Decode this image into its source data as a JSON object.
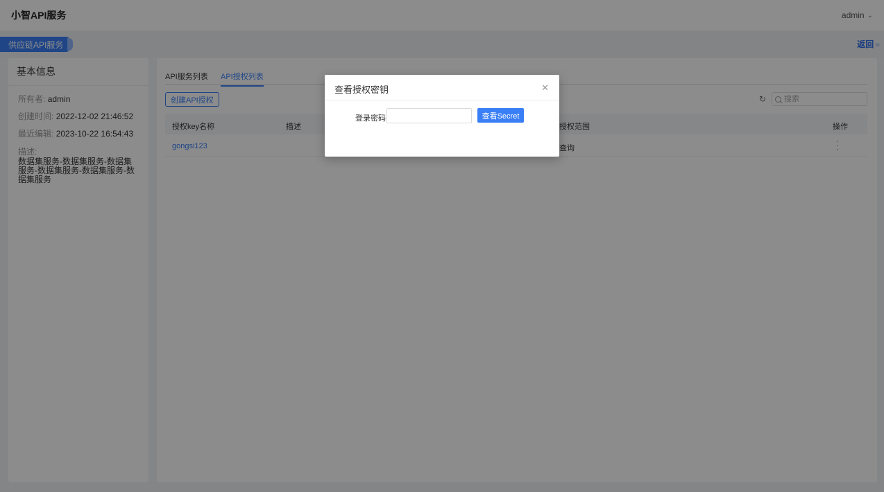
{
  "app": {
    "title": "小智API服务",
    "user": "admin"
  },
  "subbar": {
    "pill_label": "供应链API服务",
    "back_label": "返回"
  },
  "left": {
    "title": "基本信息",
    "owner_label": "所有者:",
    "owner_value": "admin",
    "created_label": "创建时间:",
    "created_value": "2022-12-02 21:46:52",
    "edited_label": "最近编辑:",
    "edited_value": "2023-10-22 16:54:43",
    "desc_label": "描述:",
    "desc_value": "数据集服务-数据集服务-数据集服务-数据集服务-数据集服务-数据集服务"
  },
  "main": {
    "tabs": [
      {
        "label": "API服务列表"
      },
      {
        "label": "API授权列表"
      }
    ],
    "create_button": "创建API授权",
    "search_placeholder": "搜索",
    "columns": [
      "授权key名称",
      "描述",
      "授权范围",
      "操作"
    ],
    "rows": [
      {
        "name": "gongsi123",
        "desc": "",
        "scope": "查询"
      }
    ]
  },
  "modal": {
    "title": "查看授权密钥",
    "password_label": "登录密码",
    "password_value": "",
    "submit_label": "查看Secret"
  },
  "icons": {
    "close": "close-icon",
    "refresh": "refresh-icon",
    "search": "search-icon",
    "more": "more-vertical-icon"
  },
  "colors": {
    "accent": "#3a7ff6"
  }
}
